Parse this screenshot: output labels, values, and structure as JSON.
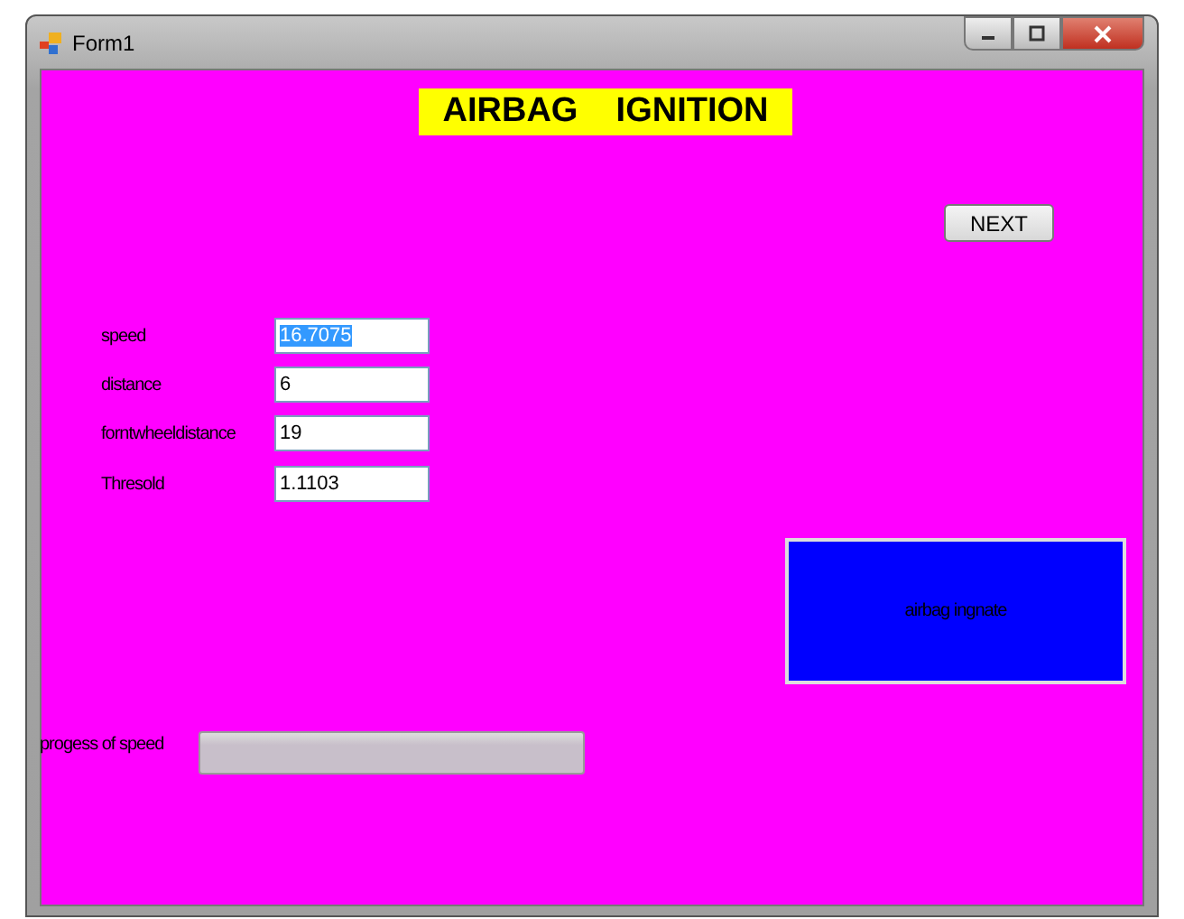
{
  "window": {
    "title": "Form1"
  },
  "heading": "AIRBAG    IGNITION",
  "next_button": "NEXT",
  "fields": [
    {
      "label": "speed",
      "value": "16.7075",
      "text_selected": true
    },
    {
      "label": "distance",
      "value": "6",
      "text_selected": false
    },
    {
      "label": "forntwheeldistance",
      "value": "19",
      "text_selected": false
    },
    {
      "label": "Thresold",
      "value": "1.1103",
      "text_selected": false
    }
  ],
  "indicator": {
    "text": "airbag ingnate"
  },
  "progress": {
    "label": "progess of speed",
    "level": 0
  }
}
